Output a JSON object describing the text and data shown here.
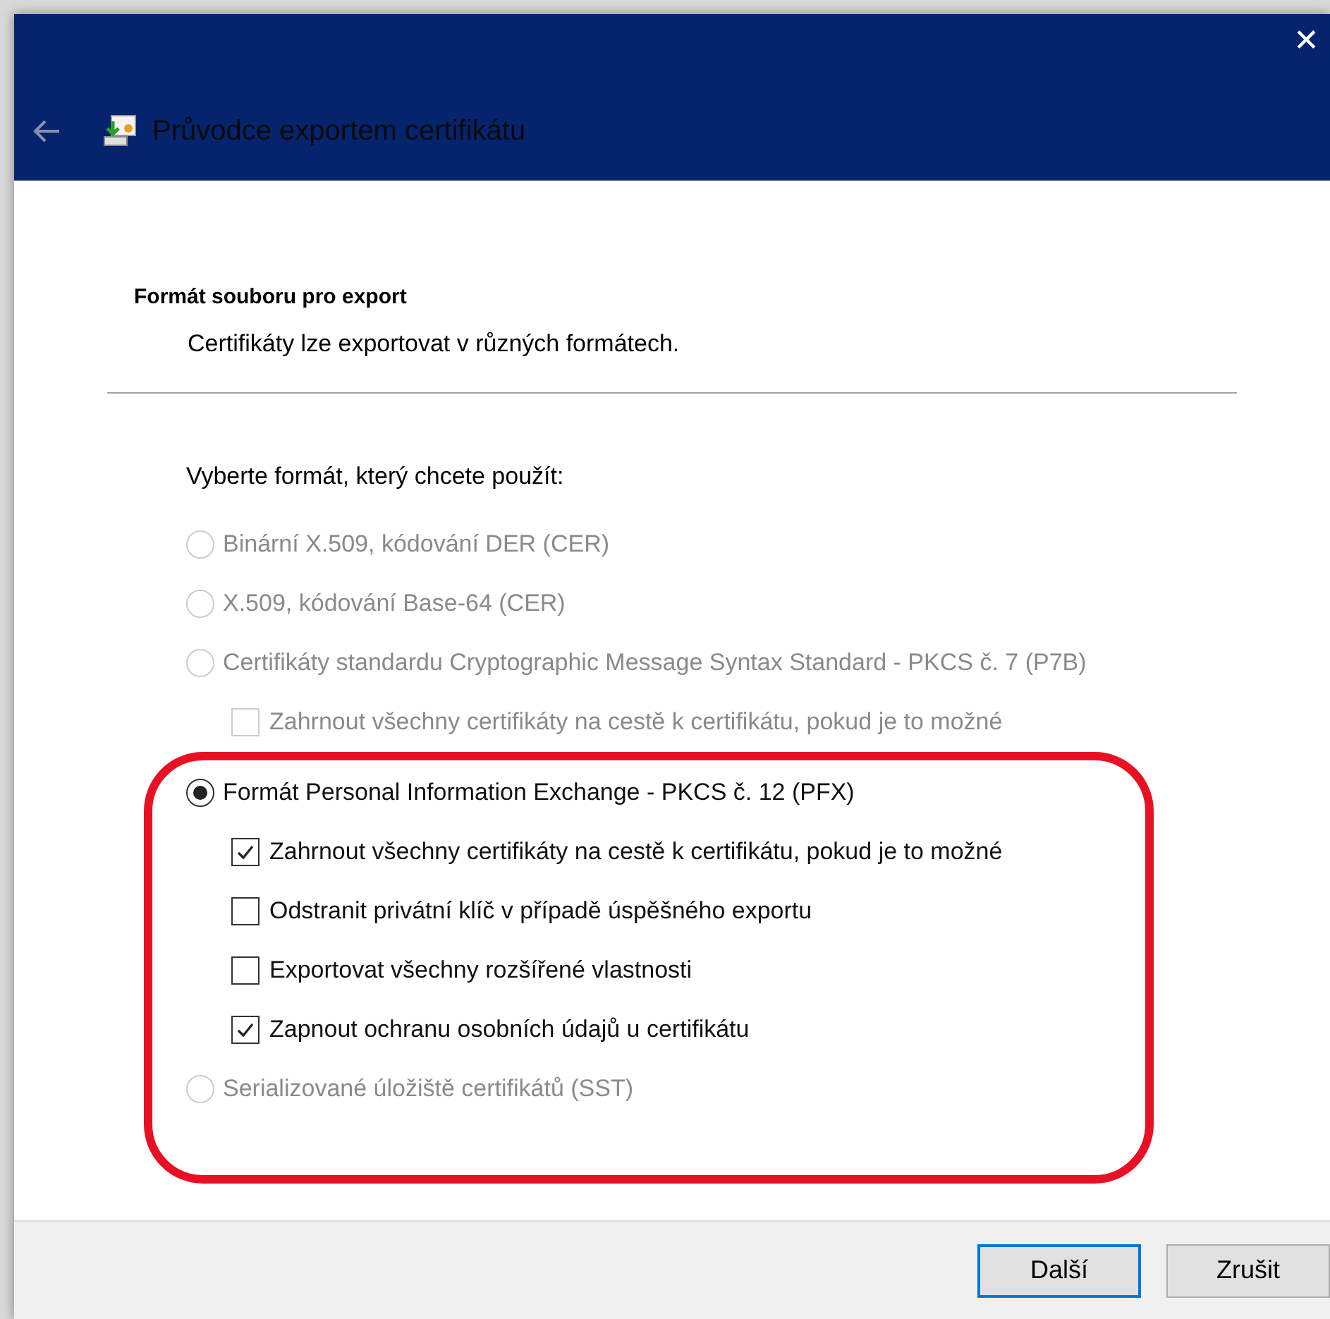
{
  "window": {
    "title": "Průvodce exportem certifikátu",
    "close": "✕"
  },
  "section": {
    "heading": "Formát souboru pro export",
    "description": "Certifikáty lze exportovat v různých formátech."
  },
  "prompt": "Vyberte formát, který chcete použít:",
  "options": [
    {
      "kind": "radio",
      "label": "Binární X.509, kódování DER (CER)",
      "selected": false,
      "disabled": true,
      "highlighted": false
    },
    {
      "kind": "radio",
      "label": "X.509, kódování Base-64 (CER)",
      "selected": false,
      "disabled": true,
      "highlighted": false
    },
    {
      "kind": "radio",
      "label": "Certifikáty standardu Cryptographic Message Syntax Standard - PKCS č. 7 (P7B)",
      "selected": false,
      "disabled": true,
      "highlighted": false,
      "children": [
        {
          "kind": "checkbox",
          "label": "Zahrnout všechny certifikáty na cestě k certifikátu, pokud je to možné",
          "checked": false,
          "disabled": true
        }
      ]
    },
    {
      "kind": "radio",
      "label": "Formát Personal Information Exchange - PKCS č. 12 (PFX)",
      "selected": true,
      "disabled": false,
      "highlighted": true,
      "children": [
        {
          "kind": "checkbox",
          "label": "Zahrnout všechny certifikáty na cestě k certifikátu, pokud je to možné",
          "checked": true,
          "disabled": false
        },
        {
          "kind": "checkbox",
          "label": "Odstranit privátní klíč v případě úspěšného exportu",
          "checked": false,
          "disabled": false
        },
        {
          "kind": "checkbox",
          "label": "Exportovat všechny rozšířené vlastnosti",
          "checked": false,
          "disabled": false
        },
        {
          "kind": "checkbox",
          "label": "Zapnout ochranu osobních údajů u certifikátu",
          "checked": true,
          "disabled": false
        }
      ]
    },
    {
      "kind": "radio",
      "label": "Serializované úložiště certifikátů (SST)",
      "selected": false,
      "disabled": true,
      "highlighted": true
    }
  ],
  "buttons": [
    {
      "label": "Další",
      "selected": true
    },
    {
      "label": "Zrušit",
      "selected": false
    }
  ]
}
